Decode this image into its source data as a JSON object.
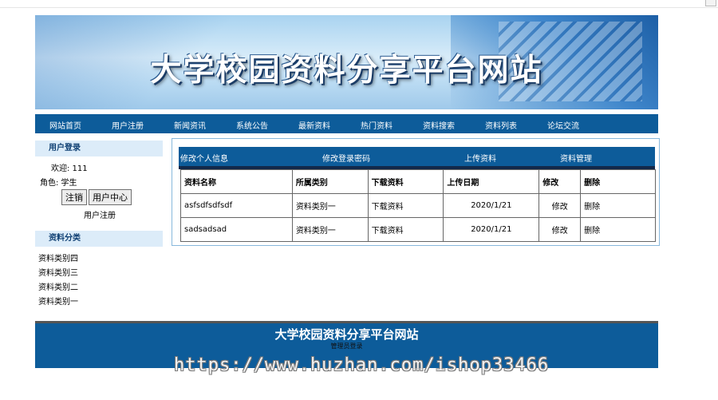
{
  "banner": {
    "title": "大学校园资料分享平台网站"
  },
  "nav": [
    "网站首页",
    "用户注册",
    "新闻资讯",
    "系统公告",
    "最新资料",
    "热门资料",
    "资料搜索",
    "资料列表",
    "论坛交流"
  ],
  "sidebar": {
    "login_header": "用户登录",
    "welcome": "欢迎: 111",
    "role": "角色:   学生",
    "logout_button": "注销",
    "usercenter_button": "用户中心",
    "register_link": "用户注册",
    "category_header": "资料分类",
    "categories": [
      "资料类别四",
      "资料类别三",
      "资料类别二",
      "资料类别一"
    ]
  },
  "panel": {
    "tabs": [
      "修改个人信息",
      "修改登录密码",
      "上传资料",
      "资料管理"
    ],
    "columns": [
      "资料名称",
      "所属类别",
      "下载资料",
      "上传日期",
      "修改",
      "删除"
    ],
    "rows": [
      [
        "asfsdfsdfsdf",
        "资料类别一",
        "下载资料",
        "2020/1/21",
        "修改",
        "删除"
      ],
      [
        "sadsadsad",
        "资料类别一",
        "下载资料",
        "2020/1/21",
        "修改",
        "删除"
      ]
    ]
  },
  "footer": {
    "title": "大学校园资料分享平台网站",
    "sub": "管理员登录"
  },
  "watermark": "https://www.huzhan.com/ishop33466"
}
